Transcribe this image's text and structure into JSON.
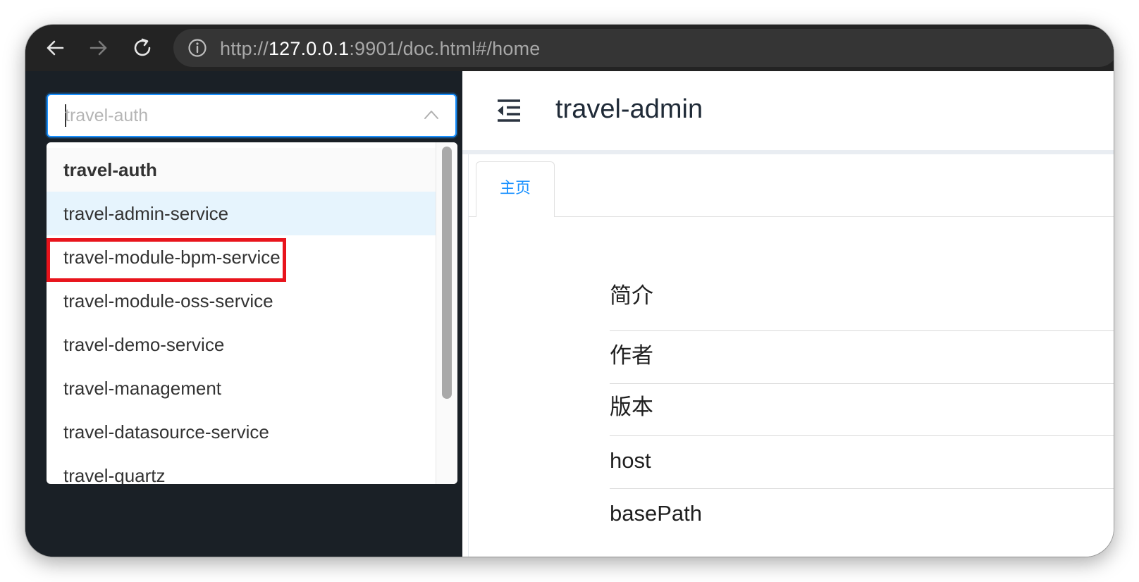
{
  "browser": {
    "url_scheme": "http://",
    "url_host": "127.0.0.1",
    "url_rest": ":9901/doc.html#/home",
    "icons": {
      "back": "arrow-left-icon",
      "forward": "arrow-right-icon",
      "reload": "reload-icon",
      "info": "info-circle-icon"
    }
  },
  "sidebar": {
    "service_select": {
      "placeholder": "travel-auth",
      "expanded": true
    },
    "options": [
      {
        "label": "travel-auth",
        "state": "selected"
      },
      {
        "label": "travel-admin-service",
        "state": "hover"
      },
      {
        "label": "travel-module-bpm-service",
        "state": "normal"
      },
      {
        "label": "travel-module-oss-service",
        "state": "normal"
      },
      {
        "label": "travel-demo-service",
        "state": "normal"
      },
      {
        "label": "travel-management",
        "state": "normal"
      },
      {
        "label": "travel-datasource-service",
        "state": "normal"
      },
      {
        "label": "travel-quartz",
        "state": "normal"
      }
    ]
  },
  "main": {
    "title": "travel-admin",
    "tabs": [
      {
        "label": "主页",
        "active": true
      }
    ],
    "info_rows": [
      "简介",
      "作者",
      "版本",
      "host",
      "basePath"
    ]
  },
  "colors": {
    "accent": "#1890ff",
    "highlight": "#e8141c",
    "sidebar_bg": "#1a2026",
    "hover_bg": "#e6f4fd"
  }
}
